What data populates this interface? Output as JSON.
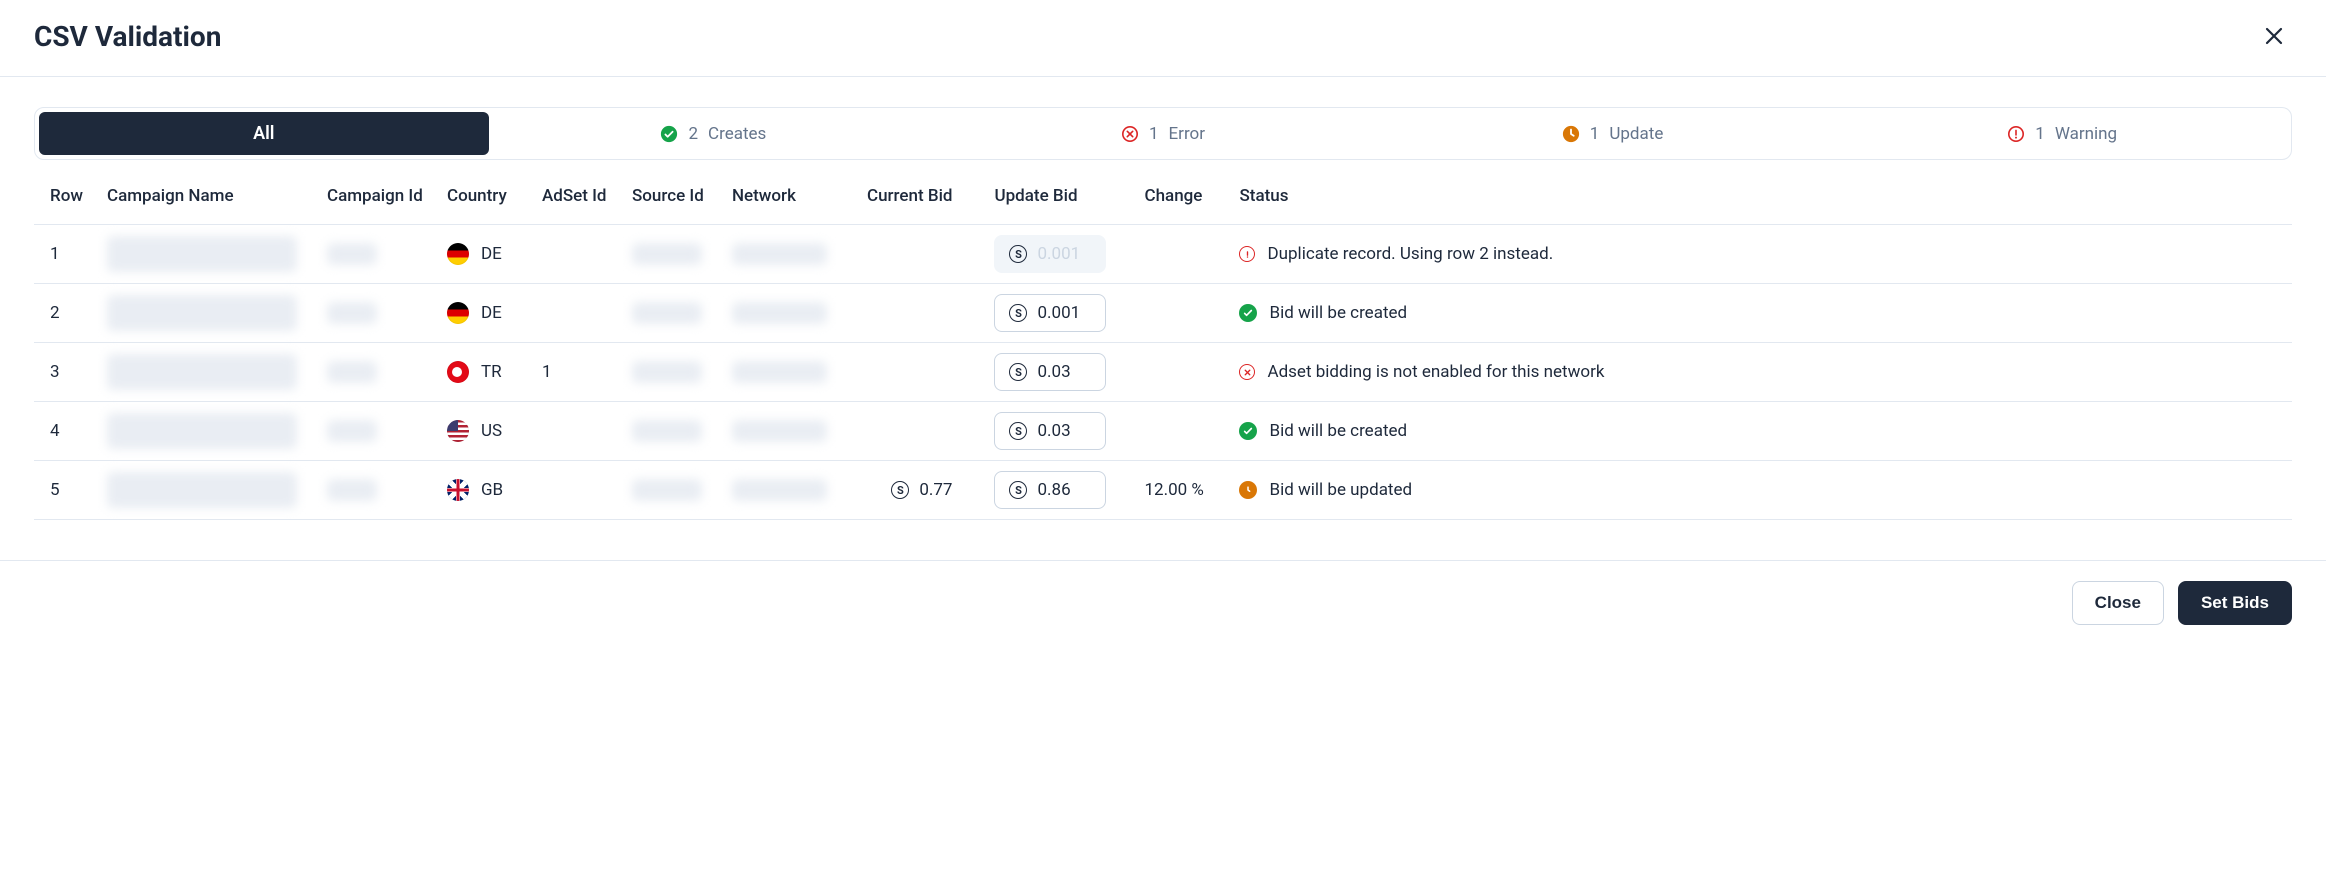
{
  "header": {
    "title": "CSV Validation"
  },
  "tabs": {
    "all": "All",
    "creates": {
      "count": 2,
      "label": "Creates"
    },
    "errors": {
      "count": 1,
      "label": "Error"
    },
    "updates": {
      "count": 1,
      "label": "Update"
    },
    "warnings": {
      "count": 1,
      "label": "Warning"
    }
  },
  "columns": {
    "row": "Row",
    "campaign_name": "Campaign Name",
    "campaign_id": "Campaign Id",
    "country": "Country",
    "adset_id": "AdSet Id",
    "source_id": "Source Id",
    "network": "Network",
    "current_bid": "Current Bid",
    "update_bid": "Update Bid",
    "change": "Change",
    "status": "Status"
  },
  "rows": [
    {
      "row": "1",
      "country": "DE",
      "adset": "",
      "current_bid": "",
      "update_bid": "0.001",
      "update_disabled": true,
      "change": "",
      "status_kind": "warning",
      "status_text": "Duplicate record. Using row 2 instead."
    },
    {
      "row": "2",
      "country": "DE",
      "adset": "",
      "current_bid": "",
      "update_bid": "0.001",
      "update_disabled": false,
      "change": "",
      "status_kind": "create",
      "status_text": "Bid will be created"
    },
    {
      "row": "3",
      "country": "TR",
      "adset": "1",
      "current_bid": "",
      "update_bid": "0.03",
      "update_disabled": false,
      "change": "",
      "status_kind": "error",
      "status_text": "Adset bidding is not enabled for this network"
    },
    {
      "row": "4",
      "country": "US",
      "adset": "",
      "current_bid": "",
      "update_bid": "0.03",
      "update_disabled": false,
      "change": "",
      "status_kind": "create",
      "status_text": "Bid will be created"
    },
    {
      "row": "5",
      "country": "GB",
      "adset": "",
      "current_bid": "0.77",
      "update_bid": "0.86",
      "update_disabled": false,
      "change": "12.00 %",
      "status_kind": "update",
      "status_text": "Bid will be updated"
    }
  ],
  "footer": {
    "close": "Close",
    "set_bids": "Set Bids"
  }
}
